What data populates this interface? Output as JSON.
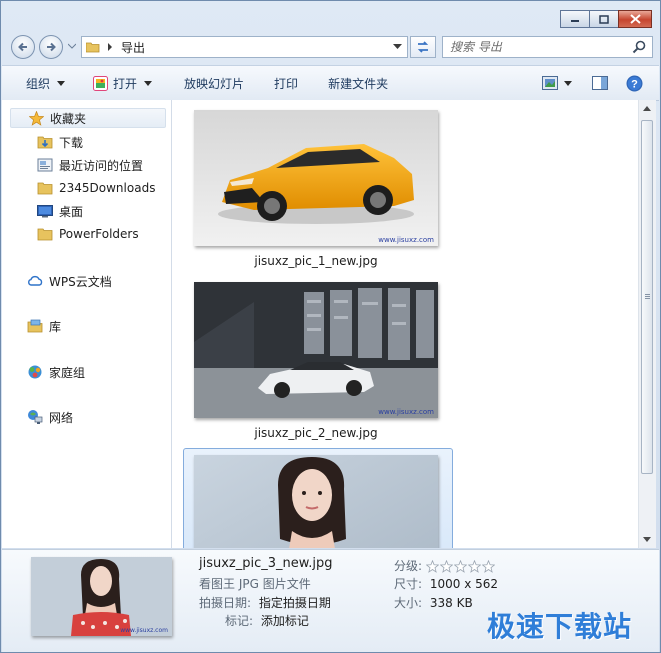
{
  "window": {
    "address_path": "导出",
    "search_placeholder": "搜索 导出"
  },
  "toolbar": {
    "organize": "组织",
    "open": "打开",
    "slideshow": "放映幻灯片",
    "print": "打印",
    "new_folder": "新建文件夹"
  },
  "sidebar": {
    "favorites": "收藏夹",
    "items": [
      "下载",
      "最近访问的位置",
      "2345Downloads",
      "桌面",
      "PowerFolders"
    ],
    "wps": "WPS云文档",
    "library": "库",
    "homegroup": "家庭组",
    "network": "网络"
  },
  "files": [
    {
      "name": "jisuxz_pic_1_new.jpg",
      "watermark": "www.jisuxz.com"
    },
    {
      "name": "jisuxz_pic_2_new.jpg",
      "watermark": "www.jisuxz.com"
    },
    {
      "name": "jisuxz_pic_3_new.jpg",
      "watermark": "www.jisuxz.com"
    }
  ],
  "details": {
    "filename": "jisuxz_pic_3_new.jpg",
    "type": "看图王 JPG 图片文件",
    "date_label": "拍摄日期:",
    "date_value": "指定拍摄日期",
    "tags_label": "标记:",
    "tags_value": "添加标记",
    "rating_label": "分级:",
    "rating": 0,
    "dims_label": "尺寸:",
    "dims_value": "1000 x 562",
    "size_label": "大小:",
    "size_value": "338 KB"
  },
  "brand": "极速下载站",
  "colors": {
    "accent": "#2f7ed8",
    "car1": "#f2a416",
    "close": "#c6452f"
  }
}
